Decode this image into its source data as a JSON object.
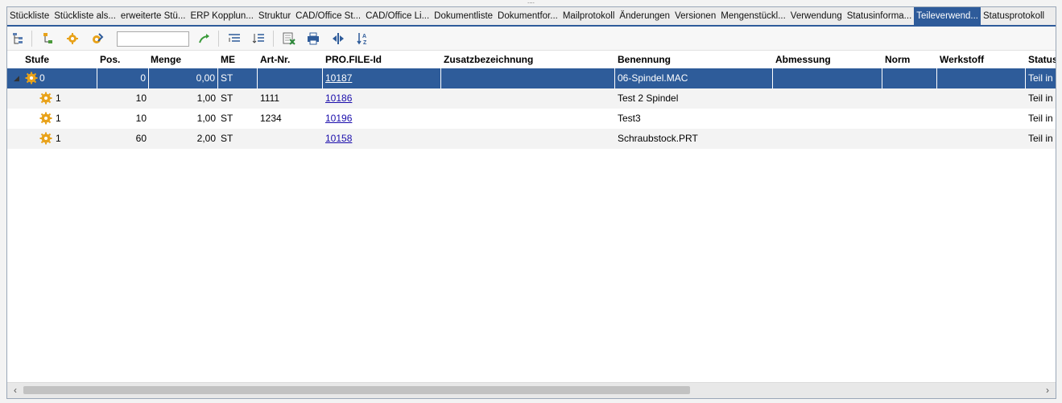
{
  "tabs": [
    {
      "label": "Stückliste"
    },
    {
      "label": "Stückliste als..."
    },
    {
      "label": "erweiterte Stü..."
    },
    {
      "label": "ERP Kopplun..."
    },
    {
      "label": "Struktur"
    },
    {
      "label": "CAD/Office St..."
    },
    {
      "label": "CAD/Office Li..."
    },
    {
      "label": "Dokumentliste"
    },
    {
      "label": "Dokumentfor..."
    },
    {
      "label": "Mailprotokoll"
    },
    {
      "label": "Änderungen"
    },
    {
      "label": "Versionen"
    },
    {
      "label": "Mengenstückl..."
    },
    {
      "label": "Verwendung"
    },
    {
      "label": "Statusinforma..."
    },
    {
      "label": "Teileverwend..."
    },
    {
      "label": "Statusprotokoll"
    }
  ],
  "active_tab": "Teileverwend...",
  "toolbar": {
    "search_value": "",
    "icons": [
      "tree-structure-icon",
      "insert-node-icon",
      "gear-settings-icon",
      "edit-gear-icon",
      "go-arrow-icon",
      "expand-all-icon",
      "collapse-all-icon",
      "excel-export-icon",
      "print-icon",
      "column-fit-icon",
      "sort-az-icon"
    ]
  },
  "columns": [
    "Stufe",
    "Pos.",
    "Menge",
    "ME",
    "Art-Nr.",
    "PRO.FILE-Id",
    "Zusatzbezeichnung",
    "Benennung",
    "Abmessung",
    "Norm",
    "Werkstoff",
    "Status"
  ],
  "rows": [
    {
      "stufe": "0",
      "pos": "0",
      "menge": "0,00",
      "me": "ST",
      "artnr": "",
      "profile_id": "10187",
      "zusatz": "",
      "benennung": "06-Spindel.MAC",
      "abmessung": "",
      "norm": "",
      "werkstoff": "",
      "status": "Teil in"
    },
    {
      "stufe": "1",
      "pos": "10",
      "menge": "1,00",
      "me": "ST",
      "artnr": "1111",
      "profile_id": "10186",
      "zusatz": "",
      "benennung": "Test 2 Spindel",
      "abmessung": "",
      "norm": "",
      "werkstoff": "",
      "status": "Teil in"
    },
    {
      "stufe": "1",
      "pos": "10",
      "menge": "1,00",
      "me": "ST",
      "artnr": "1234",
      "profile_id": "10196",
      "zusatz": "",
      "benennung": "Test3",
      "abmessung": "",
      "norm": "",
      "werkstoff": "",
      "status": "Teil in"
    },
    {
      "stufe": "1",
      "pos": "60",
      "menge": "2,00",
      "me": "ST",
      "artnr": "",
      "profile_id": "10158",
      "zusatz": "",
      "benennung": "Schraubstock.PRT",
      "abmessung": "",
      "norm": "",
      "werkstoff": "",
      "status": "Teil in"
    }
  ],
  "colors": {
    "accent": "#2e5b9a",
    "gear": "#e8a21a",
    "link": "#1a0dab"
  }
}
